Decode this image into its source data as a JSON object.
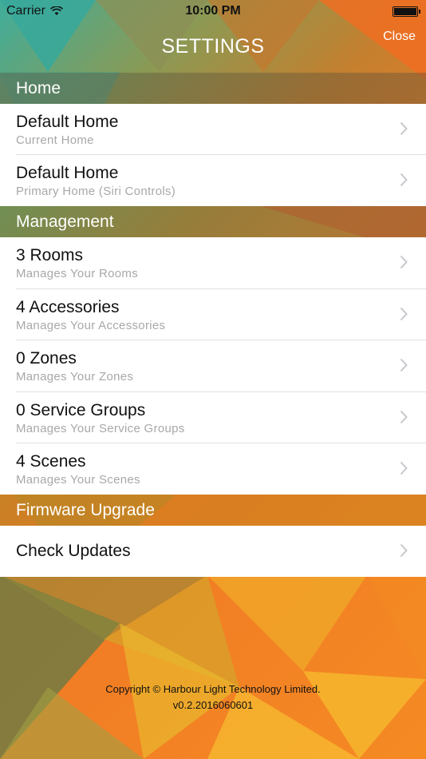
{
  "status_bar": {
    "carrier": "Carrier",
    "time": "10:00 PM"
  },
  "nav": {
    "title": "SETTINGS",
    "close_label": "Close"
  },
  "sections": [
    {
      "header": "Home",
      "rows": [
        {
          "title": "Default Home",
          "subtitle": "Current Home"
        },
        {
          "title": "Default Home",
          "subtitle": "Primary Home (Siri Controls)"
        }
      ]
    },
    {
      "header": "Management",
      "rows": [
        {
          "title": "3 Rooms",
          "subtitle": "Manages Your Rooms"
        },
        {
          "title": "4 Accessories",
          "subtitle": "Manages Your Accessories"
        },
        {
          "title": "0 Zones",
          "subtitle": "Manages Your Zones"
        },
        {
          "title": "0 Service Groups",
          "subtitle": "Manages Your Service Groups"
        },
        {
          "title": "4 Scenes",
          "subtitle": "Manages Your Scenes"
        }
      ]
    },
    {
      "header": "Firmware Upgrade",
      "rows": [
        {
          "title": "Check Updates"
        }
      ]
    }
  ],
  "footer": {
    "copyright": "Copyright © Harbour Light Technology Limited.",
    "version": "v0.2.2016060601"
  },
  "colors": {
    "accent_white": "#ffffff",
    "subtitle_gray": "#a8a8a8",
    "chevron_gray": "#c7c7cc"
  }
}
